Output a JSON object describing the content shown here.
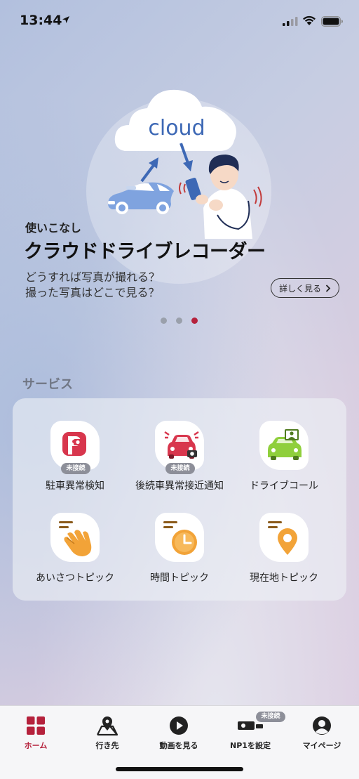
{
  "status_bar": {
    "time": "13:44"
  },
  "hero": {
    "illustration_text": "cloud",
    "kicker": "使いこなし",
    "title": "クラウドドライブレコーダー",
    "desc_line1": "どうすれば写真が撮れる？",
    "desc_line2": "撮った写真はどこで見る？",
    "detail_button": "詳しく見る",
    "pager": {
      "count": 3,
      "active_index": 2
    }
  },
  "services": {
    "heading": "サービス",
    "items": [
      {
        "label": "駐車異常検知",
        "badge": "未接続",
        "icon": "parking-camera-icon"
      },
      {
        "label": "後続車異常接近通知",
        "badge": "未接続",
        "icon": "rear-car-alert-icon"
      },
      {
        "label": "ドライブコール",
        "icon": "drive-call-icon"
      },
      {
        "label": "あいさつトピック",
        "icon": "waving-hand-icon"
      },
      {
        "label": "時間トピック",
        "icon": "clock-icon"
      },
      {
        "label": "現在地トピック",
        "icon": "location-pin-icon"
      }
    ]
  },
  "nav": {
    "items": [
      {
        "label": "ホーム",
        "icon": "home-grid-icon",
        "active": true
      },
      {
        "label": "行き先",
        "icon": "map-pin-icon"
      },
      {
        "label": "動画を見る",
        "icon": "play-icon"
      },
      {
        "label": "NP1を設定",
        "icon": "device-icon",
        "badge": "未接続"
      },
      {
        "label": "マイページ",
        "icon": "person-icon"
      }
    ]
  },
  "colors": {
    "accent": "#b5213c",
    "badge": "#8d8f99",
    "car_blue": "#7fa3df",
    "orange": "#f2a338",
    "green": "#8fcf3c"
  }
}
